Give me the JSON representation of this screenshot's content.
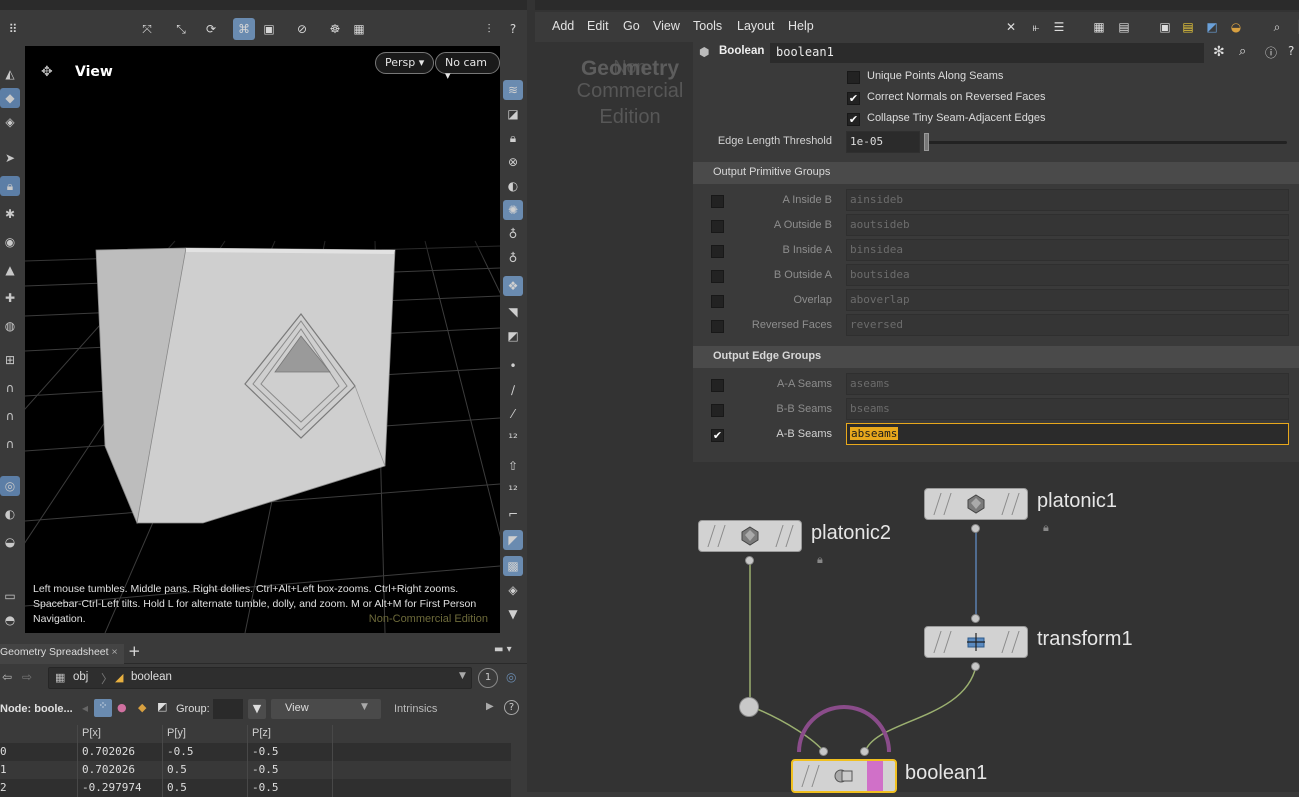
{
  "viewport": {
    "title": "View",
    "persp_label": "Persp",
    "cam_label": "No cam",
    "help_text": "Left mouse tumbles. Middle pans. Right dollies. Ctrl+Alt+Left box-zooms. Ctrl+Right zooms. Spacebar-Ctrl-Left tilts. Hold L for alternate tumble, dolly, and zoom. M or Alt+M for First Person Navigation.",
    "edition_label": "Non-Commercial Edition"
  },
  "spreadsheet": {
    "tab_label": "Geometry Spreadsheet",
    "path": [
      "obj",
      "boolean"
    ],
    "page_number": "1",
    "node_label": "Node: boole...",
    "group_label": "Group:",
    "view_label": "View",
    "intrinsics_label": "Intrinsics",
    "columns": [
      "",
      "P[x]",
      "P[y]",
      "P[z]"
    ],
    "rows": [
      [
        "0",
        "0.702026",
        "-0.5",
        "-0.5"
      ],
      [
        "1",
        "0.702026",
        "0.5",
        "-0.5"
      ],
      [
        "2",
        "-0.297974",
        "0.5",
        "-0.5"
      ]
    ]
  },
  "menubar": {
    "items": [
      "Add",
      "Edit",
      "Go",
      "View",
      "Tools",
      "Layout",
      "Help"
    ]
  },
  "watermark": {
    "line1": "Non",
    "line2": "Geometry",
    "line3": "Commercial",
    "line4": "Edition"
  },
  "params": {
    "node_type": "Boolean",
    "node_name": "boolean1",
    "checkboxes": [
      {
        "label": "Unique Points Along Seams",
        "checked": false
      },
      {
        "label": "Correct Normals on Reversed Faces",
        "checked": true
      },
      {
        "label": "Collapse Tiny Seam-Adjacent Edges",
        "checked": true
      }
    ],
    "edge_threshold_label": "Edge Length Threshold",
    "edge_threshold_value": "1e-05",
    "prim_groups_title": "Output Primitive Groups",
    "prim_groups": [
      {
        "label": "A Inside B",
        "value": "ainsideb",
        "checked": false
      },
      {
        "label": "A Outside B",
        "value": "aoutsideb",
        "checked": false
      },
      {
        "label": "B Inside A",
        "value": "binsidea",
        "checked": false
      },
      {
        "label": "B Outside A",
        "value": "boutsidea",
        "checked": false
      },
      {
        "label": "Overlap",
        "value": "aboverlap",
        "checked": false
      },
      {
        "label": "Reversed Faces",
        "value": "reversed",
        "checked": false
      }
    ],
    "edge_groups_title": "Output Edge Groups",
    "edge_groups": [
      {
        "label": "A-A Seams",
        "value": "aseams",
        "checked": false
      },
      {
        "label": "B-B Seams",
        "value": "bseams",
        "checked": false
      },
      {
        "label": "A-B Seams",
        "value": "abseams",
        "checked": true
      }
    ]
  },
  "network": {
    "nodes": {
      "platonic1": "platonic1",
      "platonic2": "platonic2",
      "transform1": "transform1",
      "boolean1": "boolean1"
    }
  },
  "colors": {
    "accent_blue": "#6a8bb0",
    "selected_field": "#e8a81c",
    "node_selected": "#f0c020",
    "boolean_flag": "#d070c8",
    "wire_green": "#9bb070",
    "wire_blue": "#5a7fb0"
  }
}
